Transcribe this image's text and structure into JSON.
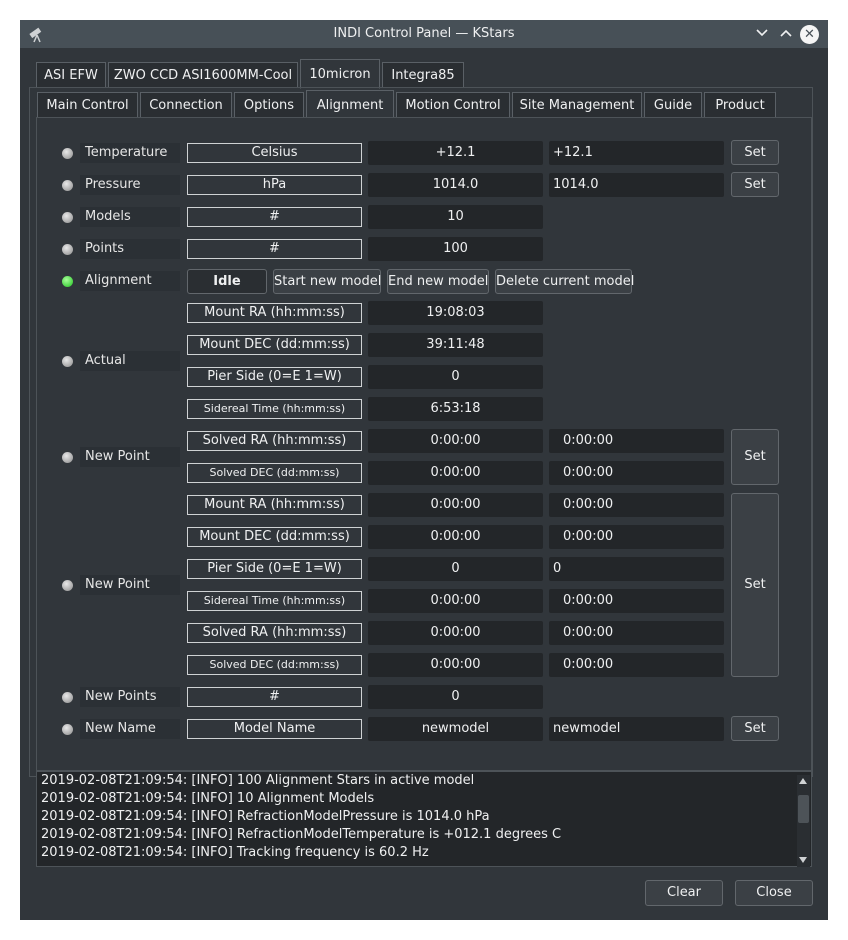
{
  "window": {
    "title": "INDI Control Panel — KStars"
  },
  "device_tabs": [
    "ASI EFW",
    "ZWO CCD ASI1600MM-Cool",
    "10micron",
    "Integra85"
  ],
  "group_tabs": [
    "Main Control",
    "Connection",
    "Options",
    "Alignment",
    "Motion Control",
    "Site Management",
    "Guide",
    "Product"
  ],
  "properties": {
    "temperature": {
      "name": "Temperature",
      "label": "Celsius",
      "value": "+12.1",
      "input": "+12.1",
      "set": "Set"
    },
    "pressure": {
      "name": "Pressure",
      "label": "hPa",
      "value": "1014.0",
      "input": "1014.0",
      "set": "Set"
    },
    "models": {
      "name": "Models",
      "label": "#",
      "value": "10"
    },
    "points": {
      "name": "Points",
      "label": "#",
      "value": "100"
    },
    "alignment": {
      "name": "Alignment",
      "state": "Idle",
      "start": "Start new model",
      "end": "End new model",
      "delete": "Delete current model"
    },
    "actual": {
      "name": "Actual",
      "rows": [
        {
          "label": "Mount RA (hh:mm:ss)",
          "value": "19:08:03"
        },
        {
          "label": "Mount DEC (dd:mm:ss)",
          "value": "39:11:48"
        },
        {
          "label": "Pier Side (0=E 1=W)",
          "value": "0"
        },
        {
          "label": "Sidereal Time (hh:mm:ss)",
          "value": "6:53:18"
        }
      ]
    },
    "new_point_1": {
      "name": "New Point",
      "set": "Set",
      "rows": [
        {
          "label": "Solved RA (hh:mm:ss)",
          "value": "0:00:00",
          "input": "0:00:00"
        },
        {
          "label": "Solved DEC (dd:mm:ss)",
          "value": "0:00:00",
          "input": "0:00:00"
        }
      ]
    },
    "new_point_2": {
      "name": "New Point",
      "set": "Set",
      "rows": [
        {
          "label": "Mount RA (hh:mm:ss)",
          "value": "0:00:00",
          "input": "0:00:00"
        },
        {
          "label": "Mount DEC (dd:mm:ss)",
          "value": "0:00:00",
          "input": "0:00:00"
        },
        {
          "label": "Pier Side (0=E 1=W)",
          "value": "0",
          "input": "0"
        },
        {
          "label": "Sidereal Time (hh:mm:ss)",
          "value": "0:00:00",
          "input": "0:00:00"
        },
        {
          "label": "Solved RA (hh:mm:ss)",
          "value": "0:00:00",
          "input": "0:00:00"
        },
        {
          "label": "Solved DEC (dd:mm:ss)",
          "value": "0:00:00",
          "input": "0:00:00"
        }
      ]
    },
    "new_points": {
      "name": "New Points",
      "label": "#",
      "value": "0"
    },
    "new_name": {
      "name": "New Name",
      "label": "Model Name",
      "value": "newmodel",
      "input": "newmodel",
      "set": "Set"
    }
  },
  "log": [
    "2019-02-08T21:09:54: [INFO] 100 Alignment Stars in active model",
    "2019-02-08T21:09:54: [INFO] 10 Alignment Models",
    "2019-02-08T21:09:54: [INFO] RefractionModelPressure is 1014.0 hPa",
    "2019-02-08T21:09:54: [INFO] RefractionModelTemperature is +012.1 degrees C",
    "2019-02-08T21:09:54: [INFO] Tracking frequency is 60.2 Hz"
  ],
  "footer": {
    "clear": "Clear",
    "close": "Close"
  }
}
